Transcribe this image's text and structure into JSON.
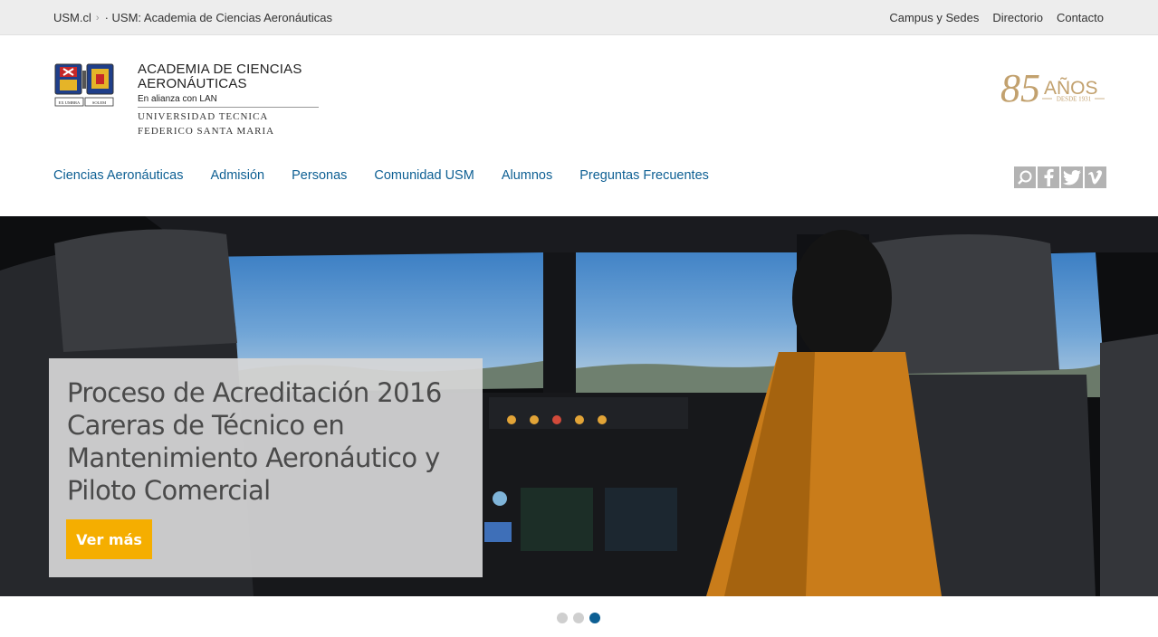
{
  "topbar": {
    "breadcrumb": [
      "USM.cl",
      "· USM: Academia de Ciencias Aeronáuticas"
    ],
    "links": [
      "Campus y Sedes",
      "Directorio",
      "Contacto"
    ]
  },
  "logo": {
    "title_line1": "ACADEMIA DE CIENCIAS",
    "title_line2": "AERONÁUTICAS",
    "subtitle": "En alianza con LAN",
    "university_line1": "UNIVERSIDAD TECNICA",
    "university_line2": "FEDERICO SANTA MARIA",
    "motto_left": "EX UMBRA",
    "motto_right": "SOLEM"
  },
  "anniversary": {
    "number": "85",
    "word": "AÑOS",
    "since": "DESDE 1931"
  },
  "nav": [
    "Ciencias Aeronáuticas",
    "Admisión",
    "Personas",
    "Comunidad USM",
    "Alumnos",
    "Preguntas Frecuentes"
  ],
  "social": [
    "search-icon",
    "facebook-icon",
    "twitter-icon",
    "vimeo-icon"
  ],
  "hero": {
    "headline": "Proceso de Acreditación 2016 Careras de Técnico en Mantenimiento Aeronáutico y Piloto Comercial",
    "cta": "Ver más"
  },
  "carousel": {
    "slides": 3,
    "active": 3
  },
  "colors": {
    "nav_link": "#0d5f93",
    "cta": "#f5ae00",
    "anniversary_gold": "#c2a16e"
  }
}
